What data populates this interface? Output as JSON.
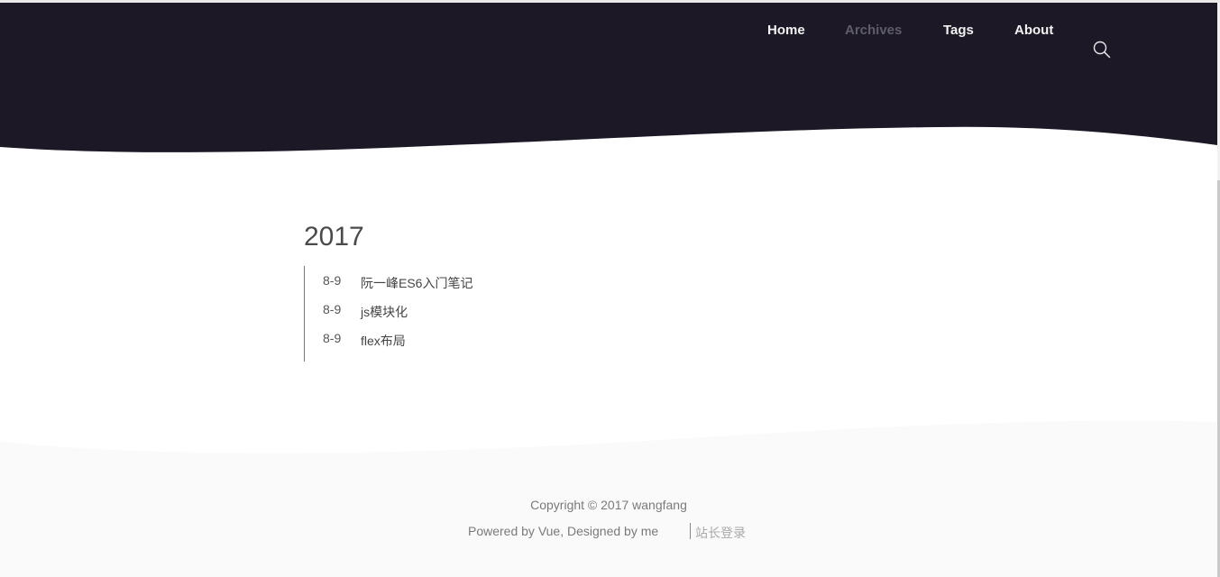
{
  "nav": {
    "items": [
      {
        "label": "Home"
      },
      {
        "label": "Archives"
      },
      {
        "label": "Tags"
      },
      {
        "label": "About"
      }
    ],
    "active": "Archives",
    "search_icon": "search-icon"
  },
  "colors": {
    "header_bg": "#1c1826",
    "nav_text": "#f2f2f2",
    "nav_active": "#5e5d69",
    "footer_bg": "#fafafa"
  },
  "archive": {
    "year": "2017",
    "posts": [
      {
        "date": "8-9",
        "title": "阮一峰ES6入门笔记"
      },
      {
        "date": "8-9",
        "title": "js模块化"
      },
      {
        "date": "8-9",
        "title": "flex布局"
      }
    ]
  },
  "footer": {
    "copyright": "Copyright © 2017 wangfang",
    "powered": "Powered by Vue, Designed by me",
    "login": "站长登录"
  }
}
